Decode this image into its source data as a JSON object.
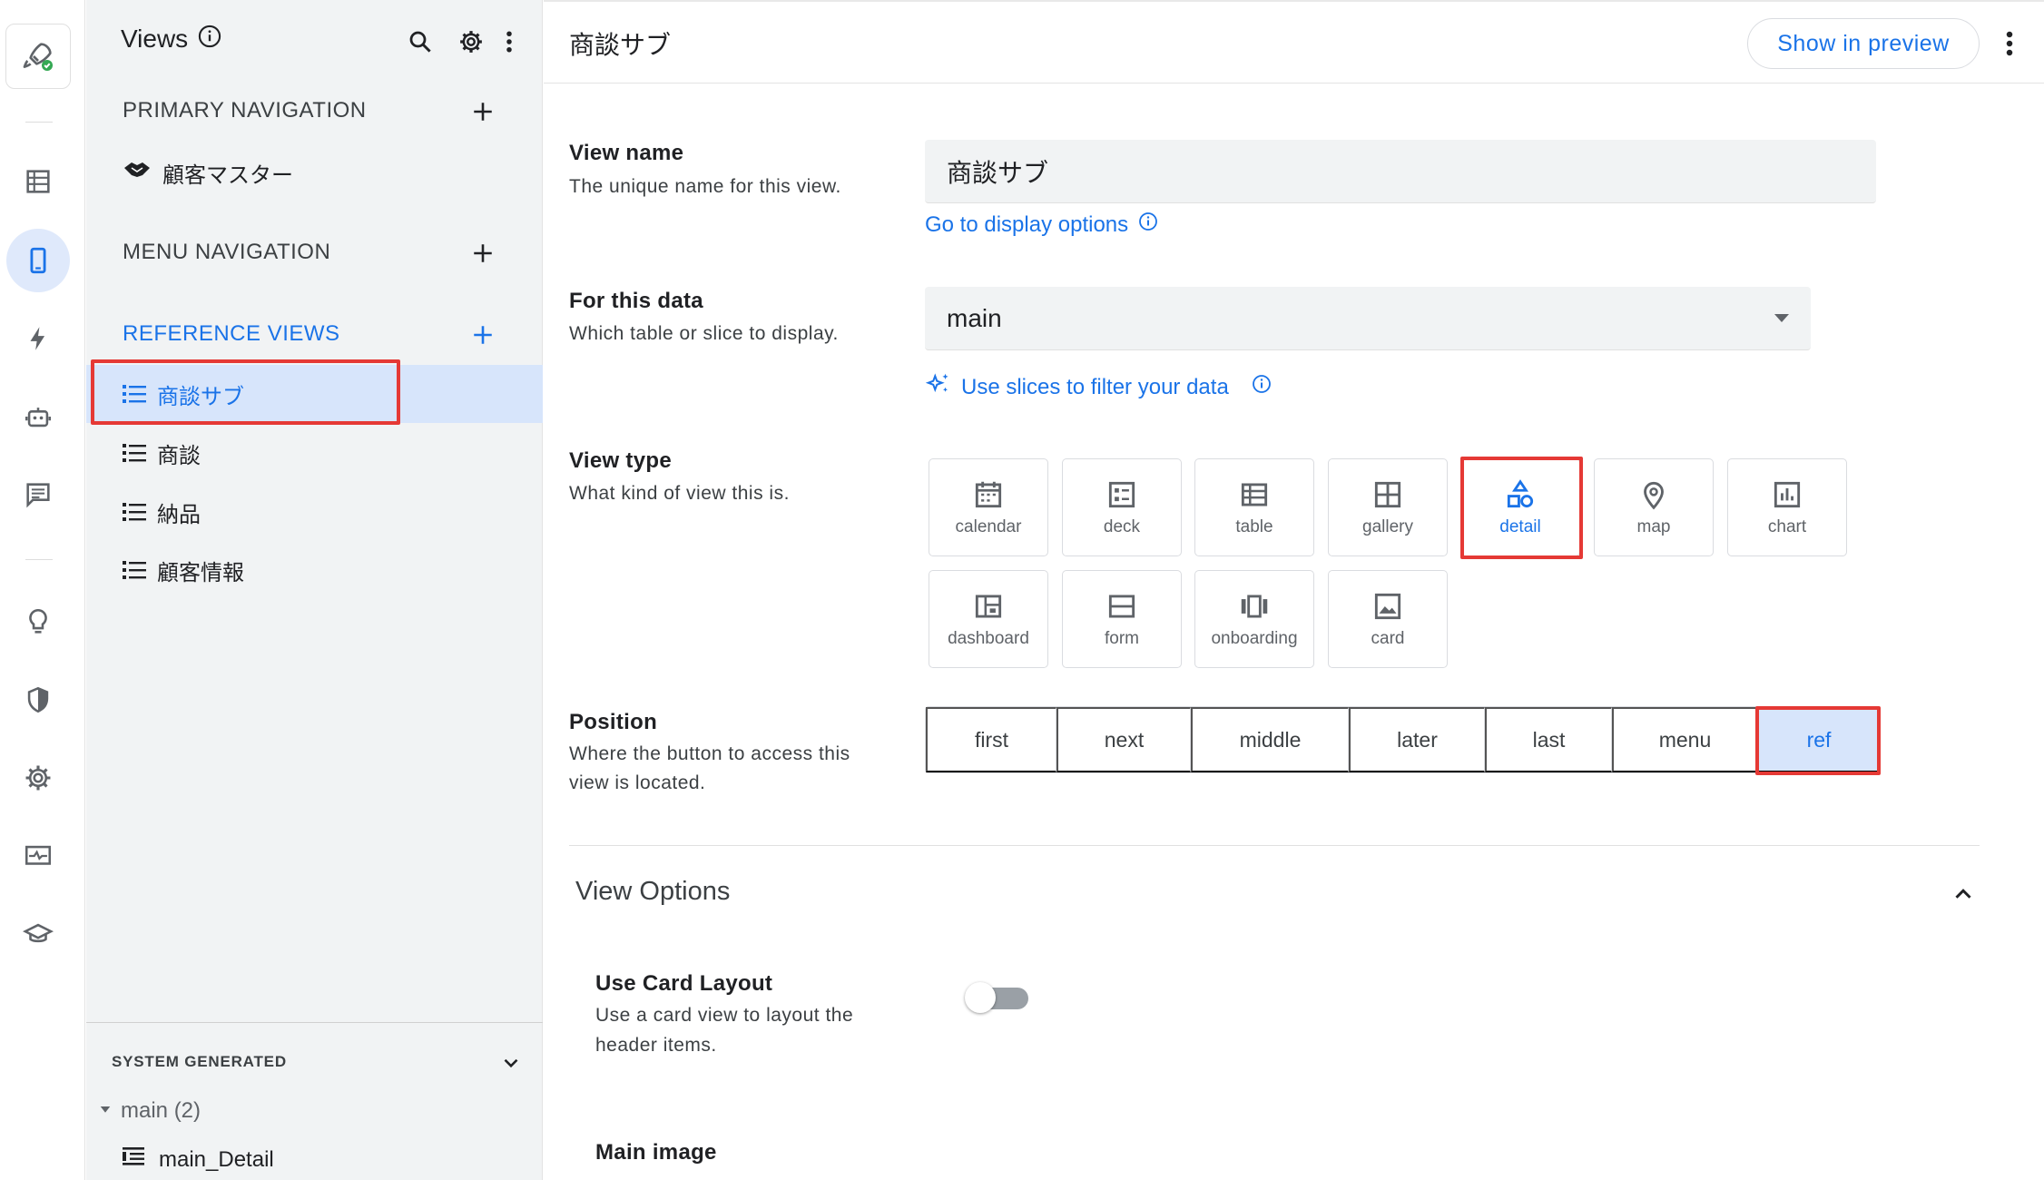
{
  "rail": {
    "icons": [
      "app-logo-icon",
      "data-table-icon",
      "mobile-view-icon",
      "bolt-icon",
      "robot-icon",
      "chat-icon",
      "lightbulb-icon",
      "shield-icon",
      "gear-icon",
      "monitor-pulse-icon",
      "graduation-cap-icon"
    ],
    "active": "mobile-view-icon"
  },
  "panel": {
    "title": "Views",
    "primary_nav": {
      "heading": "PRIMARY NAVIGATION",
      "items": [
        {
          "label": "顧客マスター",
          "icon": "handshake-icon"
        }
      ]
    },
    "menu_nav": {
      "heading": "MENU NAVIGATION"
    },
    "reference_views": {
      "heading": "REFERENCE VIEWS",
      "items": [
        {
          "label": "商談サブ",
          "selected": true
        },
        {
          "label": "商談"
        },
        {
          "label": "納品"
        },
        {
          "label": "顧客情報"
        }
      ]
    },
    "system_generated": {
      "heading": "SYSTEM GENERATED",
      "group": "main (2)",
      "items": [
        {
          "label": "main_Detail"
        }
      ]
    }
  },
  "header": {
    "title": "商談サブ",
    "preview_button": "Show in preview"
  },
  "form": {
    "view_name": {
      "label": "View name",
      "desc": "The unique name for this view.",
      "value": "商談サブ",
      "link": "Go to display options"
    },
    "for_this_data": {
      "label": "For this data",
      "desc": "Which table or slice to display.",
      "value": "main",
      "link": "Use slices to filter your data"
    },
    "view_type": {
      "label": "View type",
      "desc": "What kind of view this is.",
      "options": [
        "calendar",
        "deck",
        "table",
        "gallery",
        "detail",
        "map",
        "chart",
        "dashboard",
        "form",
        "onboarding",
        "card"
      ],
      "selected": "detail"
    },
    "position": {
      "label": "Position",
      "desc_line1": "Where the button to access this",
      "desc_line2": "view is located.",
      "options": [
        "first",
        "next",
        "middle",
        "later",
        "last",
        "menu",
        "ref"
      ],
      "selected": "ref"
    },
    "view_options": {
      "title": "View Options",
      "card_layout": {
        "label": "Use Card Layout",
        "desc_line1": "Use a card view to layout the",
        "desc_line2": "header items.",
        "enabled": false
      },
      "main_image": {
        "label": "Main image"
      }
    }
  },
  "colors": {
    "accent": "#1a73e8",
    "highlight": "#e53935",
    "selected_bg": "#d7e5fb"
  }
}
